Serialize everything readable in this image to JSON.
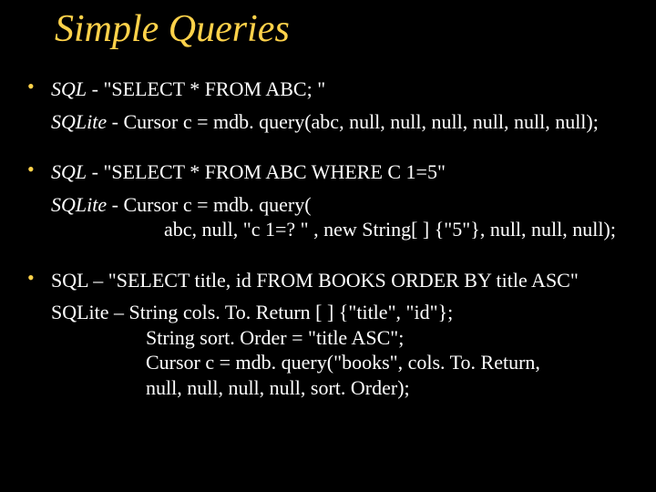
{
  "title": "Simple Queries",
  "b1": {
    "line1_prefix": "SQL",
    "line1_rest": "  -  \"SELECT * FROM ABC; \"",
    "line2_prefix": "SQLite",
    "line2_rest": "  -  Cursor c = mdb. query(abc, null, null, null, null, null, null);"
  },
  "b2": {
    "line1_prefix": "SQL",
    "line1_rest": " - \"SELECT * FROM ABC WHERE C 1=5\"",
    "line2_prefix": "SQLite",
    "line2_rest": " - Cursor c = mdb. query(",
    "line3": "abc, null, \"c 1=? \" , new String[ ] {\"5\"}, null, null, null);"
  },
  "b3": {
    "line1": " SQL – \"SELECT title, id FROM BOOKS ORDER BY title ASC\"",
    "line2": " SQLite – String cols. To. Return [ ] {\"title\", \"id\"};",
    "line3": "String sort. Order = \"title ASC\";",
    "line4": "Cursor c = mdb. query(\"books\", cols. To. Return,",
    "line5": " null, null, null, null, sort. Order);"
  }
}
